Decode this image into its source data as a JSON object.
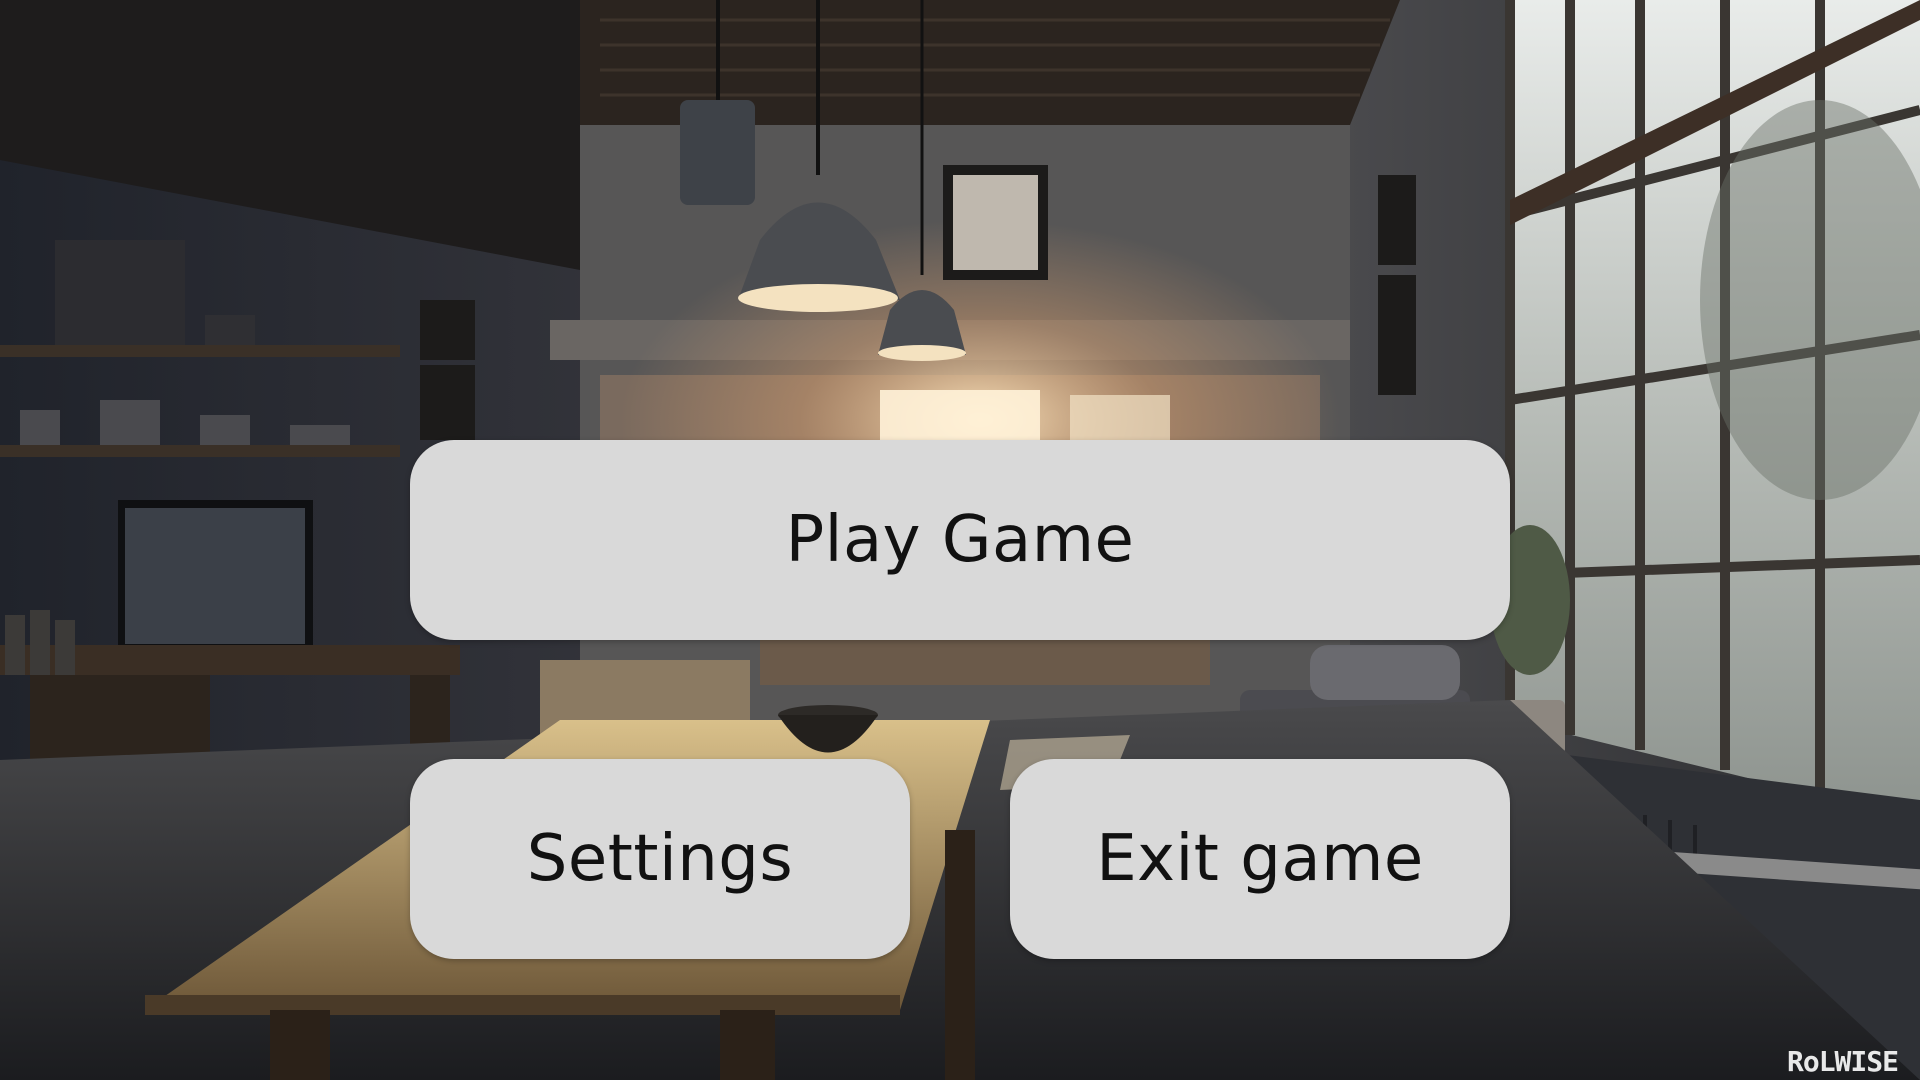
{
  "menu": {
    "play_label": "Play Game",
    "settings_label": "Settings",
    "exit_label": "Exit game"
  },
  "watermark": "RoLWISE",
  "colors": {
    "button_bg": "#d9d9d9",
    "button_text": "#111111",
    "window_light": "#fff2d8",
    "room_shadow": "#1a1c22"
  }
}
